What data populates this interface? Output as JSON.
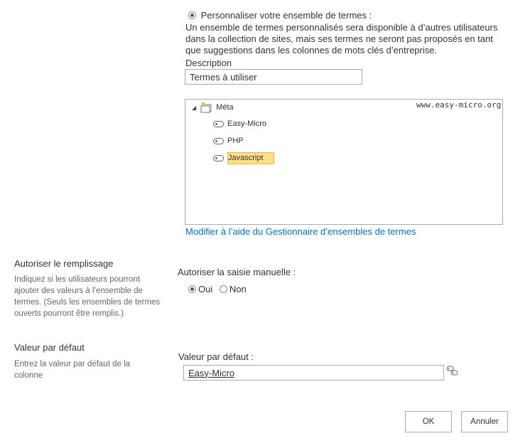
{
  "termset": {
    "custom_option_label": "Personnaliser votre ensemble de termes :",
    "custom_description_lines": [
      "Un ensemble de termes personnalisés sera disponible à d’autres utilisateurs",
      "dans la collection de sites, mais ses termes ne seront pas proposés en tant",
      "que suggestions dans les colonnes de mots clés d’entreprise."
    ],
    "description_label": "Description",
    "description_value": "Termes à utiliser",
    "tree": {
      "root_label": "Méta",
      "watermark": "www.easy-micro.org",
      "items": [
        "Easy-Micro",
        "PHP",
        "Javascript"
      ]
    },
    "manage_link": "Modifier à l’aide du Gestionnaire d’ensembles de termes"
  },
  "fill_in": {
    "title": "Autoriser le remplissage",
    "help_lines": [
      "Indiquez si les utilisateurs pourront",
      "ajouter des valeurs à l’ensemble de",
      "termes. (Seuls les ensembles de termes",
      "ouverts pourront être remplis.)"
    ],
    "question_label": "Autoriser la saisie manuelle :",
    "yes_label": "Oui",
    "no_label": "Non"
  },
  "default_value": {
    "title": "Valeur par défaut",
    "help_lines": [
      "Entrez la valeur par défaut de la",
      "colonne"
    ],
    "field_label": "Valeur par défaut :",
    "field_value": "Easy-Micro"
  },
  "buttons": {
    "ok_label": "OK",
    "cancel_label": "Annuler"
  },
  "colors": {
    "link": "#0072c6",
    "selection": "#fedf8a"
  }
}
